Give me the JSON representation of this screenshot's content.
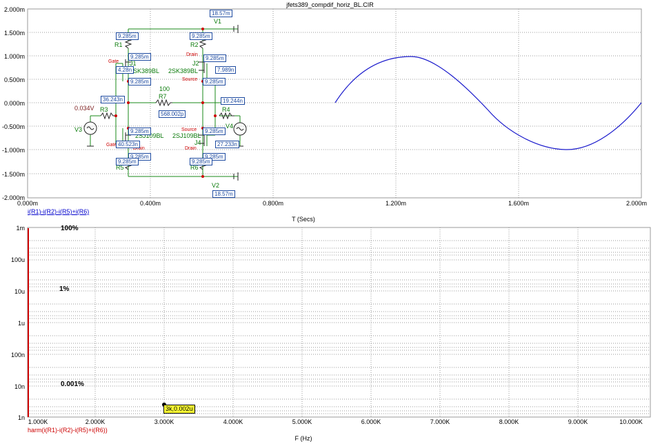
{
  "window_title": "jfets389_compdif_horiz_BL.CIR",
  "top_plot": {
    "y_ticks": [
      "2.000m",
      "1.500m",
      "1.000m",
      "0.500m",
      "0.000m",
      "-0.500m",
      "-1.000m",
      "-1.500m",
      "-2.000m"
    ],
    "x_ticks": [
      "0.000m",
      "0.400m",
      "0.800m",
      "1.200m",
      "1.600m",
      "2.000m"
    ],
    "x_axis_title": "T (Secs)",
    "trace_label": "i(R1)-i(R2)-i(R5)+i(R6)",
    "trace_color": "#1a1acc"
  },
  "bottom_plot": {
    "y_ticks": [
      "1m",
      "100u",
      "10u",
      "1u",
      "100n",
      "10n",
      "1n"
    ],
    "x_ticks": [
      "1.000K",
      "2.000K",
      "3.000K",
      "4.000K",
      "5.000K",
      "6.000K",
      "7.000K",
      "8.000K",
      "9.000K",
      "10.000K"
    ],
    "x_axis_title": "F (Hz)",
    "trace_label": "harm(i(R1)-i(R2)-i(R5)+i(R6))",
    "trace_color": "#cc0000",
    "pct_100": "100%",
    "pct_1": "1%",
    "pct_0001": "0.001%",
    "cursor_tag": "3k,0.002u"
  },
  "schematic": {
    "top_current": "18.57m",
    "bottom_current": "18.57m",
    "v1": "V1",
    "v2": "V2",
    "v3": "V3",
    "v4": "V4",
    "r1": "R1",
    "r2": "R2",
    "r3": "R3",
    "r4": "R4",
    "r5": "R5",
    "r6": "R6",
    "r7": "R7",
    "j1": "J1",
    "j2": "J2",
    "j3_part": "2SJ109BL",
    "j4": "J4",
    "j4_part": "2SJ109BL",
    "part_2sk": "2SK389BL",
    "part_2sk_b": "2SK389BL",
    "r7_value": "100",
    "v3_value": "0.034V",
    "gate": "Gate",
    "drain": "Drain",
    "source": "Source",
    "c_9285a": "9.285m",
    "c_9285b": "9.285m",
    "c_9285c": "9.285m",
    "c_9285d": "9.285m",
    "c_9285e": "9.285m",
    "c_9285f": "9.285m",
    "c_9285g": "9.285m",
    "c_9285h": "9.285m",
    "c_9285i": "9.285m",
    "c_9285j": "9.285m",
    "c_9285k": "9.285m",
    "c_9285l": "9.285m",
    "c_9285m": "9.285m",
    "c_9285n": "9.285m",
    "c_428n": "4.28n",
    "c_7989n": "7.989n",
    "c_36243n": "36.243n",
    "c_568p": "568.002p",
    "c_19244n": "19.244n",
    "c_40523n": "40.523n",
    "c_27233n": "27.233n"
  }
}
